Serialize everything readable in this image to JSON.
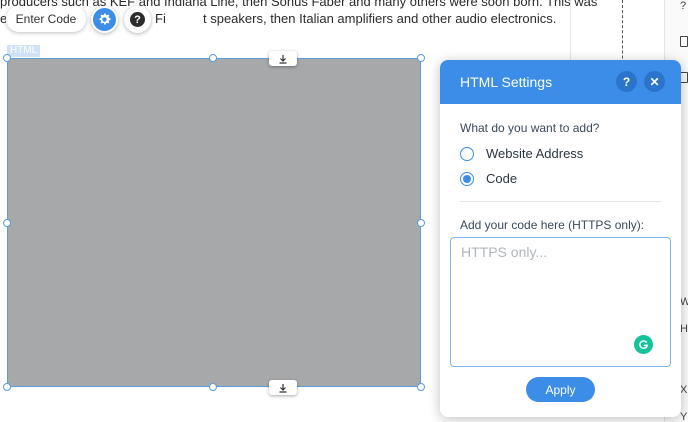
{
  "article": {
    "line1": "producers such as KEF and Indiana Line, then Sonus Faber and many others were soon born. This was",
    "line2_left": "e",
    "line2_mid": "Fi",
    "line2_right": "t speakers, then Italian amplifiers and other audio electronics."
  },
  "toolbar": {
    "enter_code_label": "Enter Code",
    "settings_icon": "gear-icon",
    "help_icon": "help-icon",
    "help_glyph": "?"
  },
  "element": {
    "tag_label": "HTML",
    "fill_color": "#a7a8aa",
    "outline_color": "#5b9be0"
  },
  "panel": {
    "title": "HTML Settings",
    "help_glyph": "?",
    "close_glyph": "✕",
    "question": "What do you want to add?",
    "options": [
      {
        "label": "Website Address",
        "selected": false
      },
      {
        "label": "Code",
        "selected": true
      }
    ],
    "code_label": "Add your code here (HTTPS only):",
    "code_placeholder": "HTTPS only...",
    "code_value": "",
    "apply_label": "Apply",
    "accent_color": "#3b8de8"
  },
  "right_strip": {
    "glyphs": [
      "?",
      "W",
      "H",
      "X",
      "Y"
    ]
  }
}
